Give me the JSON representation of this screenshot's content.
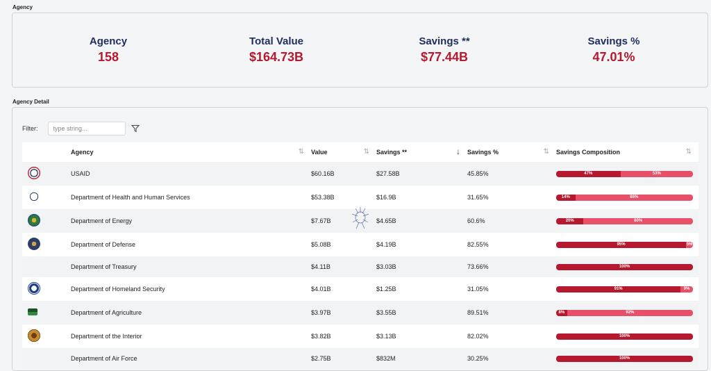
{
  "summary": {
    "section_label": "Agency",
    "kpis": [
      {
        "label": "Agency",
        "value": "158"
      },
      {
        "label": "Total Value",
        "value": "$164.73B"
      },
      {
        "label": "Savings **",
        "value": "$77.44B"
      },
      {
        "label": "Savings %",
        "value": "47.01%"
      }
    ]
  },
  "detail": {
    "section_label": "Agency Detail",
    "filter_label": "Filter:",
    "filter_placeholder": "type string...",
    "filter_value": "",
    "columns": [
      "Agency",
      "Value",
      "Savings **",
      "Savings %",
      "Savings Composition"
    ],
    "sort_column": "Savings **",
    "sort_direction": "descending",
    "rows": [
      {
        "agency": "USAID",
        "value": "$60.16B",
        "savings": "$27.58B",
        "savings_pct": "45.85%",
        "comp_a": 47,
        "comp_a_label": "47%",
        "comp_b_label": "53%",
        "logo": "usaid-seal-icon"
      },
      {
        "agency": "Department of Health and Human Services",
        "value": "$53.38B",
        "savings": "$16.9B",
        "savings_pct": "31.65%",
        "comp_a": 14,
        "comp_a_label": "14%",
        "comp_b_label": "86%",
        "logo": "hhs-seal-icon"
      },
      {
        "agency": "Department of Energy",
        "value": "$7.67B",
        "savings": "$4.65B",
        "savings_pct": "60.6%",
        "comp_a": 20,
        "comp_a_label": "20%",
        "comp_b_label": "80%",
        "logo": "doe-seal-icon"
      },
      {
        "agency": "Department of Defense",
        "value": "$5.08B",
        "savings": "$4.19B",
        "savings_pct": "82.55%",
        "comp_a": 95,
        "comp_a_label": "95%",
        "comp_b_label": "5%",
        "logo": "dod-seal-icon"
      },
      {
        "agency": "Department of Treasury",
        "value": "$4.11B",
        "savings": "$3.03B",
        "savings_pct": "73.66%",
        "comp_a": 100,
        "comp_a_label": "100%",
        "comp_b_label": "",
        "logo": ""
      },
      {
        "agency": "Department of Homeland Security",
        "value": "$4.01B",
        "savings": "$1.25B",
        "savings_pct": "31.05%",
        "comp_a": 91,
        "comp_a_label": "91%",
        "comp_b_label": "9%",
        "logo": "dhs-seal-icon"
      },
      {
        "agency": "Department of Agriculture",
        "value": "$3.97B",
        "savings": "$3.55B",
        "savings_pct": "89.51%",
        "comp_a": 8,
        "comp_a_label": "8%",
        "comp_b_label": "92%",
        "logo": "usda-logo-icon"
      },
      {
        "agency": "Department of the Interior",
        "value": "$3.82B",
        "savings": "$3.13B",
        "savings_pct": "82.02%",
        "comp_a": 100,
        "comp_a_label": "100%",
        "comp_b_label": "",
        "logo": "doi-seal-icon"
      },
      {
        "agency": "Department of Air Force",
        "value": "$2.75B",
        "savings": "$832M",
        "savings_pct": "30.25%",
        "comp_a": 100,
        "comp_a_label": "100%",
        "comp_b_label": "",
        "logo": ""
      }
    ]
  },
  "colors": {
    "kpi_label": "#1f2d5c",
    "kpi_value": "#b5182f",
    "bar_primary": "#b5182f",
    "bar_secondary": "#e8506a"
  }
}
